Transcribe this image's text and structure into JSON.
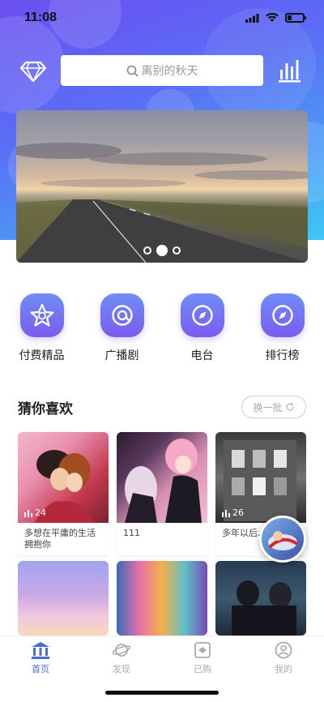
{
  "status_bar": {
    "time": "11:08"
  },
  "search": {
    "placeholder": "离别的秋天"
  },
  "banner": {
    "pages": 3,
    "active_page": 2
  },
  "categories": [
    {
      "label": "付费精品",
      "icon": "star-icon"
    },
    {
      "label": "广播剧",
      "icon": "q-icon"
    },
    {
      "label": "电台",
      "icon": "compass-icon"
    },
    {
      "label": "排行榜",
      "icon": "compass-icon"
    }
  ],
  "recommend": {
    "title": "猜你喜欢",
    "refresh_label": "换一批"
  },
  "cards": [
    {
      "plays": "24",
      "caption": "多想在平庸的生活拥抱你"
    },
    {
      "plays": "",
      "caption": "111"
    },
    {
      "plays": "26",
      "caption": "多年以后...欢.mp3"
    },
    {
      "plays": "",
      "caption": ""
    },
    {
      "plays": "",
      "caption": ""
    },
    {
      "plays": "",
      "caption": ""
    }
  ],
  "tabbar": [
    {
      "label": "首页",
      "icon": "home-icon",
      "active": true
    },
    {
      "label": "发现",
      "icon": "planet-icon",
      "active": false
    },
    {
      "label": "已购",
      "icon": "purchased-icon",
      "active": false
    },
    {
      "label": "我的",
      "icon": "profile-icon",
      "active": false
    }
  ],
  "colors": {
    "accent": "#4b6cd8",
    "icon_gradient_top": "#6e8df5",
    "icon_gradient_bottom": "#7b5cf0"
  }
}
